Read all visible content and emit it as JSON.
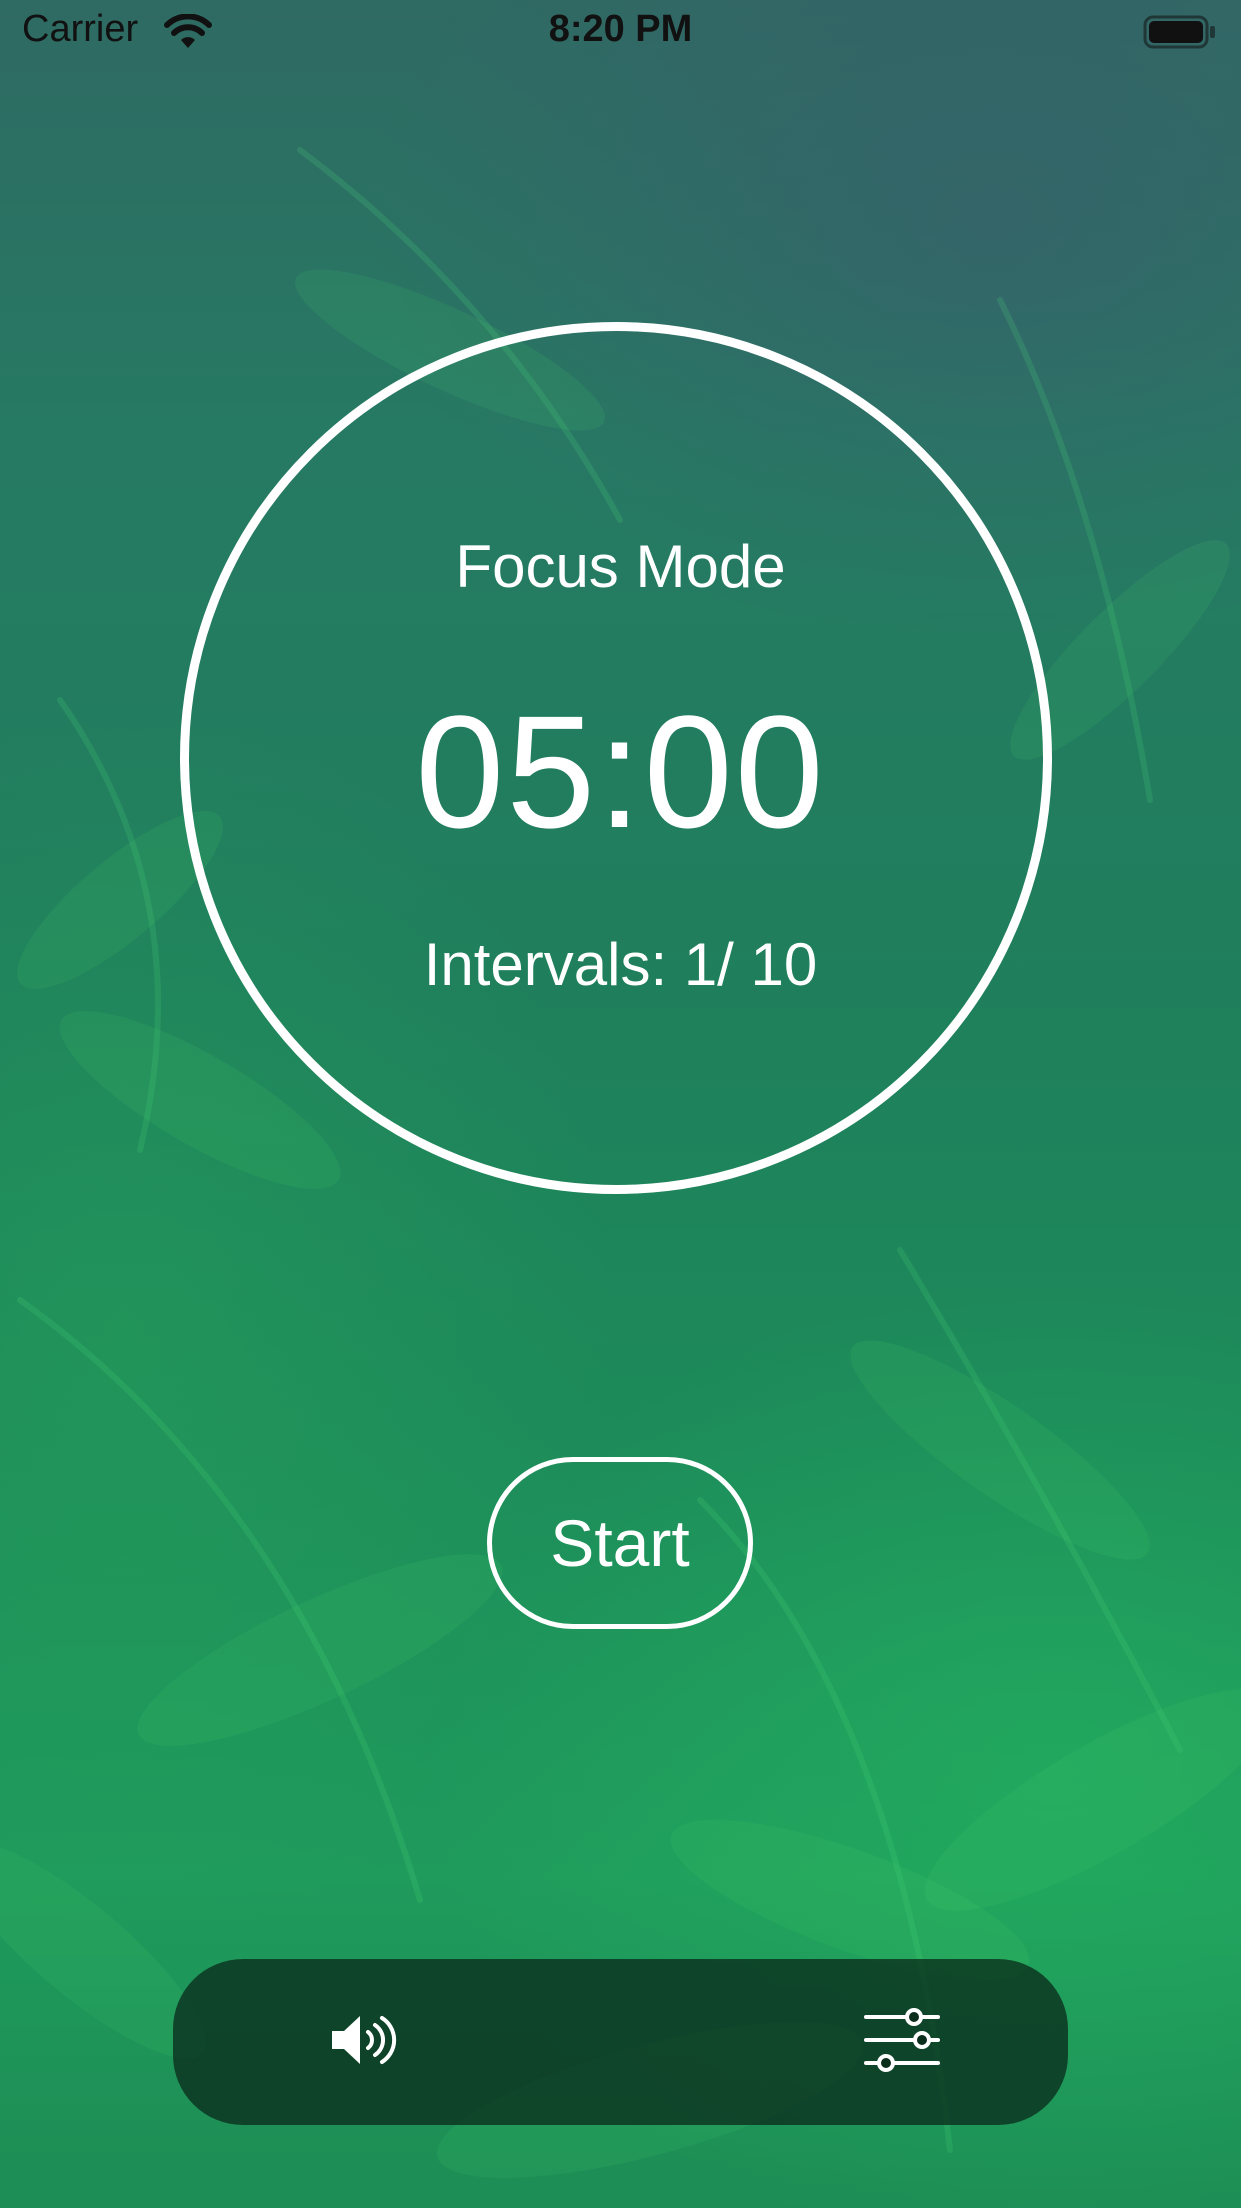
{
  "status_bar": {
    "carrier": "Carrier",
    "time": "8:20 PM",
    "wifi_icon": "wifi-icon",
    "battery_icon": "battery-icon"
  },
  "timer": {
    "mode": "Focus Mode",
    "remaining": "05:00",
    "intervals": "Intervals: 1/  10"
  },
  "controls": {
    "start_label": "Start"
  },
  "toolbar": {
    "sound_icon": "speaker-icon",
    "settings_icon": "sliders-icon"
  },
  "colors": {
    "accent": "#ffffff",
    "background_top": "#2f6a63",
    "background_bottom": "#1d8d55",
    "toolbar": "#0a2d1c"
  }
}
